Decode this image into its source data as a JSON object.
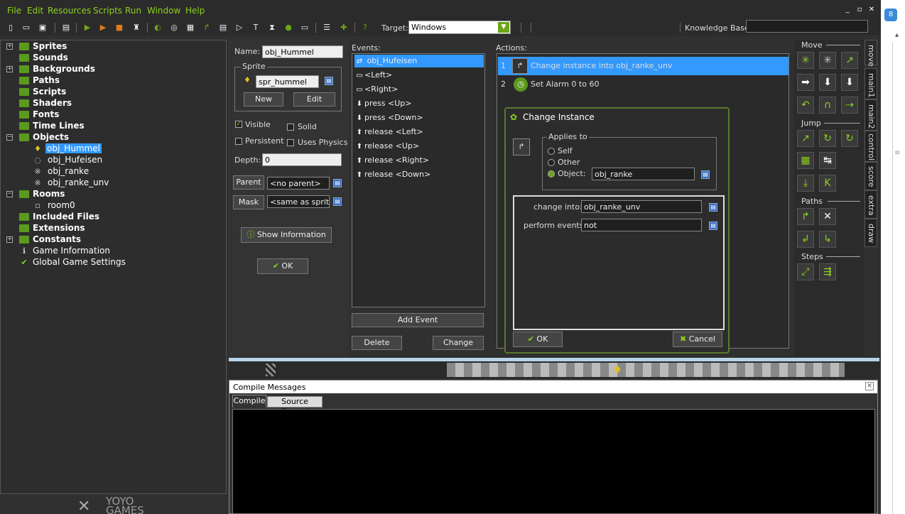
{
  "menu": [
    "File",
    "Edit",
    "Resources",
    "Scripts",
    "Run",
    "Window",
    "Help"
  ],
  "window_controls": [
    "_",
    "▫",
    "✕"
  ],
  "toolbar": {
    "target_label": "Target:",
    "target_value": "Windows",
    "knowledge_base_label": "Knowledge Base:",
    "knowledge_base_value": ""
  },
  "tree": {
    "items": [
      {
        "label": "Sprites"
      },
      {
        "label": "Sounds"
      },
      {
        "label": "Backgrounds"
      },
      {
        "label": "Paths"
      },
      {
        "label": "Scripts"
      },
      {
        "label": "Shaders"
      },
      {
        "label": "Fonts"
      },
      {
        "label": "Time Lines"
      },
      {
        "label": "Objects"
      },
      {
        "label": "obj_Hummel"
      },
      {
        "label": "obj_Hufeisen"
      },
      {
        "label": "obj_ranke"
      },
      {
        "label": "obj_ranke_unv"
      },
      {
        "label": "Rooms"
      },
      {
        "label": "room0"
      },
      {
        "label": "Included Files"
      },
      {
        "label": "Extensions"
      },
      {
        "label": "Constants"
      },
      {
        "label": "Game Information"
      },
      {
        "label": "Global Game Settings"
      }
    ],
    "logo_top": "YOYO",
    "logo_bottom": "GAMES"
  },
  "object": {
    "name_label": "Name:",
    "name_value": "obj_Hummel",
    "sprite_group": "Sprite",
    "sprite_value": "spr_hummel",
    "new_btn": "New",
    "edit_btn": "Edit",
    "visible": "Visible",
    "solid": "Solid",
    "persistent": "Persistent",
    "uses_physics": "Uses Physics",
    "depth_label": "Depth:",
    "depth_value": "0",
    "parent_btn": "Parent",
    "parent_value": "<no parent>",
    "mask_btn": "Mask",
    "mask_value": "<same as sprite>",
    "show_info": "Show Information",
    "ok": "OK"
  },
  "events": {
    "label": "Events:",
    "items": [
      "obj_Hufeisen",
      "<Left>",
      "<Right>",
      "press <Up>",
      "press <Down>",
      "release <Left>",
      "release <Up>",
      "release <Right>",
      "release <Down>"
    ],
    "add_event": "Add Event",
    "delete": "Delete",
    "change": "Change"
  },
  "actions": {
    "label": "Actions:",
    "items": [
      {
        "num": "1",
        "text": "Change instance into obj_ranke_unv"
      },
      {
        "num": "2",
        "text": "Set Alarm 0 to 60"
      }
    ]
  },
  "dialog": {
    "title": "Change Instance",
    "applies_to": "Applies to",
    "self": "Self",
    "other": "Other",
    "object": "Object:",
    "object_value": "obj_ranke",
    "change_into_label": "change into:",
    "change_into_value": "obj_ranke_unv",
    "perform_events_label": "perform events:",
    "perform_events_value": "not",
    "ok": "OK",
    "cancel": "Cancel"
  },
  "library": {
    "sections": [
      "Move",
      "Jump",
      "Paths",
      "Steps"
    ],
    "tabs": [
      "move",
      "main1",
      "main2",
      "control",
      "score",
      "extra",
      "draw"
    ]
  },
  "compile": {
    "title": "Compile Messages",
    "tabs": [
      "Compile",
      "Source Control"
    ]
  }
}
